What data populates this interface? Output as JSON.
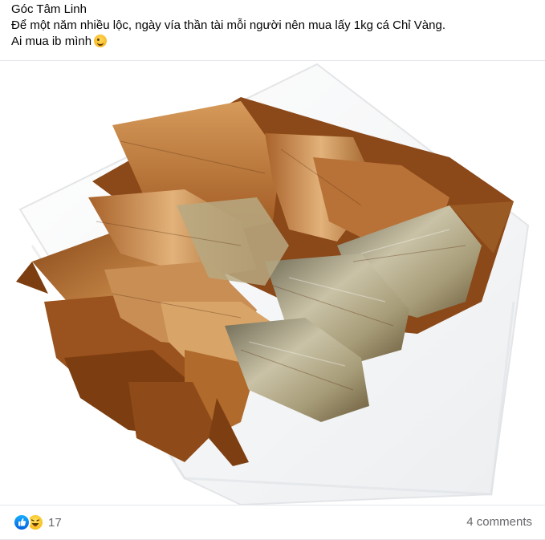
{
  "post": {
    "author": "Góc Tâm Linh",
    "text_line1": " Để một năm nhiều lộc, ngày vía thần tài mỗi người nên mua lấy 1kg cá Chỉ Vàng.",
    "text_line2": "Ai mua ib mình",
    "emoji": "wink-emoji"
  },
  "photo": {
    "subject": "dried-yellowstripe-fish-on-plate-image"
  },
  "footer": {
    "reaction_icons": [
      "like-icon",
      "haha-icon"
    ],
    "reaction_count": "17",
    "comments_label": "4 comments"
  },
  "colors": {
    "like_blue": "#1877f2",
    "haha_yellow": "#f7b928",
    "secondary_text": "#65676b",
    "divider": "#e4e6eb"
  }
}
